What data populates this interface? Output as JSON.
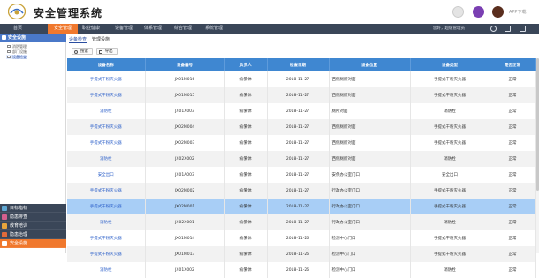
{
  "app": {
    "title": "安全管理系统",
    "download": "APP下载"
  },
  "colors": {
    "nav_bg": "#3a4658",
    "nav_active": "#f0782d",
    "sidebar_head": "#4a78c8",
    "table_head": "#3f87d1",
    "selected_row": "#a8cef6",
    "link": "#2b5fc9"
  },
  "nav": {
    "items": [
      "首页",
      "安全管理",
      "职业健康",
      "设备管理",
      "体系管理",
      "综合管理",
      "系统管理"
    ],
    "active_index": 1,
    "greeting": "您好，超级管理员"
  },
  "sidebar": {
    "title": "安全设施",
    "items": [
      "消防管理",
      "部门设施",
      "设备检查"
    ],
    "selected_index": 2,
    "modules": [
      {
        "label": "目标指标",
        "color": "#5fa8d3"
      },
      {
        "label": "隐患排查",
        "color": "#d35f8d"
      },
      {
        "label": "教育培训",
        "color": "#e7a53c"
      },
      {
        "label": "隐患治理",
        "color": "#e06a3a"
      },
      {
        "label": "安全设施",
        "color": "#f0782d"
      }
    ]
  },
  "tabs": {
    "items": [
      "设备检查",
      "管理设施"
    ],
    "active_index": 0
  },
  "toolbar": {
    "search": "搜索",
    "export": "导出"
  },
  "table": {
    "columns": [
      "设备名称",
      "设备编号",
      "负责人",
      "检查日期",
      "设备位置",
      "设备类型",
      "是否正常"
    ],
    "rows": [
      [
        "手提式干粉灭火器",
        "JX01M016",
        "俞繁体",
        "2018-11-27",
        "西侧厕所对面",
        "手提式干粉灭火器",
        "正常"
      ],
      [
        "手提式干粉灭火器",
        "JX01M015",
        "俞繁体",
        "2018-11-27",
        "西侧厕所对面",
        "手提式干粉灭火器",
        "正常"
      ],
      [
        "消防栓",
        "JX01X003",
        "俞繁体",
        "2018-11-27",
        "厕所对面",
        "消防栓",
        "正常"
      ],
      [
        "手提式干粉灭火器",
        "JX02M004",
        "俞繁体",
        "2018-11-27",
        "西侧厕所对面",
        "手提式干粉灭火器",
        "正常"
      ],
      [
        "手提式干粉灭火器",
        "JX02M003",
        "俞繁体",
        "2018-11-27",
        "西侧厕所对面",
        "手提式干粉灭火器",
        "正常"
      ],
      [
        "消防栓",
        "JX02X002",
        "俞繁体",
        "2018-11-27",
        "西侧厕所对面",
        "消防栓",
        "正常"
      ],
      [
        "安全出口",
        "JX01A003",
        "俞繁体",
        "2018-11-27",
        "安保办公室门口",
        "安全出口",
        "正常"
      ],
      [
        "手提式干粉灭火器",
        "JX02M002",
        "俞繁体",
        "2018-11-27",
        "行政办公室门口",
        "手提式干粉灭火器",
        "正常"
      ],
      [
        "手提式干粉灭火器",
        "JX02M001",
        "俞繁体",
        "2018-11-27",
        "行政办公室门口",
        "手提式干粉灭火器",
        "正常"
      ],
      [
        "消防栓",
        "JX02X001",
        "俞繁体",
        "2018-11-27",
        "行政办公室门口",
        "消防栓",
        "正常"
      ],
      [
        "手提式干粉灭火器",
        "JX01M014",
        "俞繁体",
        "2018-11-26",
        "检测中心门口",
        "手提式干粉灭火器",
        "正常"
      ],
      [
        "手提式干粉灭火器",
        "JX01M013",
        "俞繁体",
        "2018-11-26",
        "检测中心门口",
        "手提式干粉灭火器",
        "正常"
      ],
      [
        "消防栓",
        "JX01X002",
        "俞繁体",
        "2018-11-26",
        "检测中心门口",
        "消防栓",
        "正常"
      ]
    ],
    "selected_row_index": 8
  }
}
